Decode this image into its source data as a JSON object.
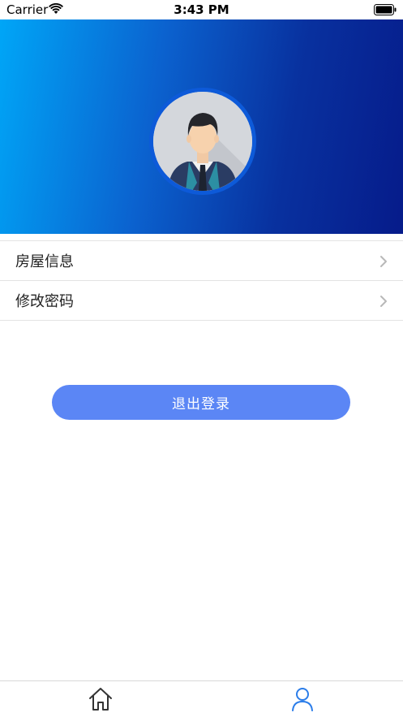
{
  "status_bar": {
    "carrier": "Carrier",
    "time": "3:43 PM",
    "icons": [
      "wifi-icon",
      "battery-icon"
    ]
  },
  "header": {
    "gradient_colors": [
      "#00a6f7",
      "#0b62cf",
      "#061b8a"
    ],
    "avatar_icon": "avatar-man-in-suit"
  },
  "menu": {
    "items": [
      {
        "label": "房屋信息",
        "icon": "chevron-right-icon"
      },
      {
        "label": "修改密码",
        "icon": "chevron-right-icon"
      }
    ]
  },
  "logout": {
    "label": "退出登录",
    "color": "#5b86f5"
  },
  "tab_bar": {
    "tabs": [
      {
        "icon": "home-icon",
        "active": false
      },
      {
        "icon": "profile-icon",
        "active": true,
        "color": "#2b7de9"
      }
    ]
  }
}
